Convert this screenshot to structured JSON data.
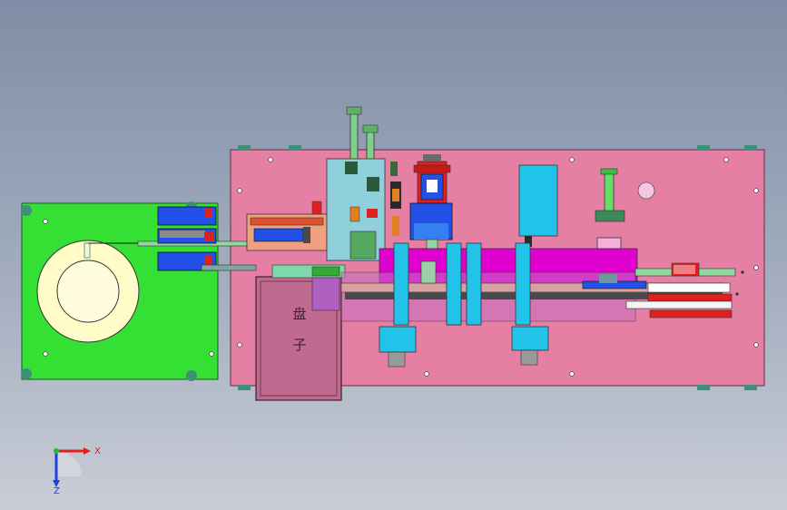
{
  "tray": {
    "label_line1": "盘",
    "label_line2": "子"
  },
  "axes": {
    "x_label": "X",
    "z_label": "Z"
  },
  "colors": {
    "background_top": "#7f8ea6",
    "base_plate": "#e57fa4",
    "feeder_plate": "#33e033",
    "reel": "#fffcc8",
    "rail": "#e000d0",
    "cyan_part": "#22c3e8",
    "blue_part": "#2250e8",
    "red_part": "#e02020",
    "tray": "#c06a90",
    "axis_x": "#e02020",
    "axis_y": "#20c020",
    "axis_z": "#2040e0"
  }
}
